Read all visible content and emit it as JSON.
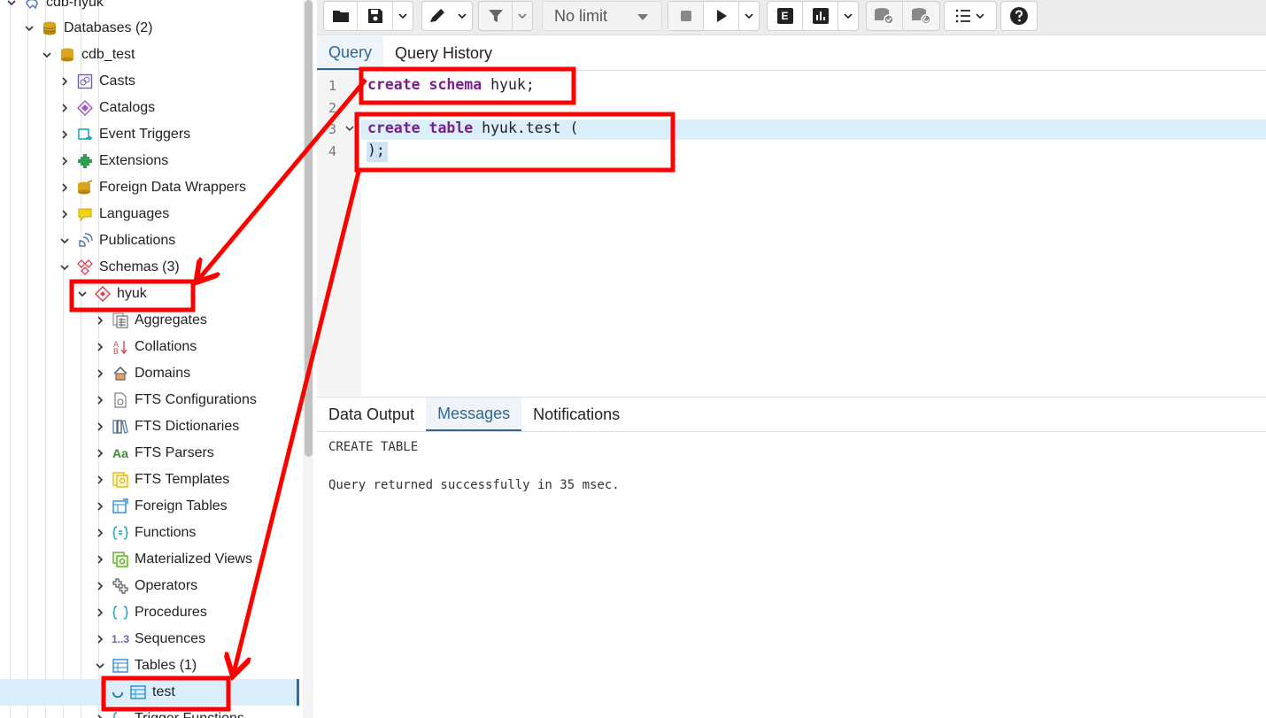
{
  "tree": {
    "items": [
      {
        "label": "cdb-hyuk",
        "icon": "elephant-icon"
      },
      {
        "label": "Databases (2)",
        "icon": "databases-icon"
      },
      {
        "label": "cdb_test",
        "icon": "database-icon"
      },
      {
        "label": "Casts",
        "icon": "casts-icon"
      },
      {
        "label": "Catalogs",
        "icon": "catalogs-icon"
      },
      {
        "label": "Event Triggers",
        "icon": "event-triggers-icon"
      },
      {
        "label": "Extensions",
        "icon": "extensions-icon"
      },
      {
        "label": "Foreign Data Wrappers",
        "icon": "foreign-data-wrappers-icon"
      },
      {
        "label": "Languages",
        "icon": "languages-icon"
      },
      {
        "label": "Publications",
        "icon": "publications-icon"
      },
      {
        "label": "Schemas (3)",
        "icon": "schemas-icon"
      },
      {
        "label": "hyuk",
        "icon": "schema-icon"
      },
      {
        "label": "Aggregates",
        "icon": "aggregates-icon"
      },
      {
        "label": "Collations",
        "icon": "collations-icon"
      },
      {
        "label": "Domains",
        "icon": "domains-icon"
      },
      {
        "label": "FTS Configurations",
        "icon": "fts-configurations-icon"
      },
      {
        "label": "FTS Dictionaries",
        "icon": "fts-dictionaries-icon"
      },
      {
        "label": "FTS Parsers",
        "icon": "fts-parsers-icon"
      },
      {
        "label": "FTS Templates",
        "icon": "fts-templates-icon"
      },
      {
        "label": "Foreign Tables",
        "icon": "foreign-tables-icon"
      },
      {
        "label": "Functions",
        "icon": "functions-icon"
      },
      {
        "label": "Materialized Views",
        "icon": "materialized-views-icon"
      },
      {
        "label": "Operators",
        "icon": "operators-icon"
      },
      {
        "label": "Procedures",
        "icon": "procedures-icon"
      },
      {
        "label": "Sequences",
        "icon": "sequences-icon"
      },
      {
        "label": "Tables (1)",
        "icon": "tables-icon"
      },
      {
        "label": "test",
        "icon": "table-icon"
      },
      {
        "label": "Trigger Functions",
        "icon": "trigger-functions-icon"
      }
    ],
    "parsers_glyph": "Aa",
    "sequences_glyph": "1..3"
  },
  "toolbar": {
    "limit_value": "No limit",
    "explain_glyph": "E"
  },
  "query_tabs": [
    "Query",
    "Query History"
  ],
  "editor": {
    "line_numbers": [
      "1",
      "2",
      "3",
      "4"
    ],
    "lines": [
      {
        "kw1": "create",
        "kw2": "schema",
        "rest": " hyuk;"
      },
      {
        "text": ""
      },
      {
        "kw1": "create",
        "kw2": "table",
        "rest": " hyuk.test ("
      },
      {
        "text": ");"
      }
    ]
  },
  "result_tabs": [
    "Data Output",
    "Messages",
    "Notifications"
  ],
  "messages": {
    "line1": "CREATE TABLE",
    "line2": "Query returned successfully in 35 msec."
  },
  "colors": {
    "annotation": "#ff0000",
    "accent": "#326690",
    "keyword": "#7a1d8e",
    "selection": "#dbeefc"
  }
}
